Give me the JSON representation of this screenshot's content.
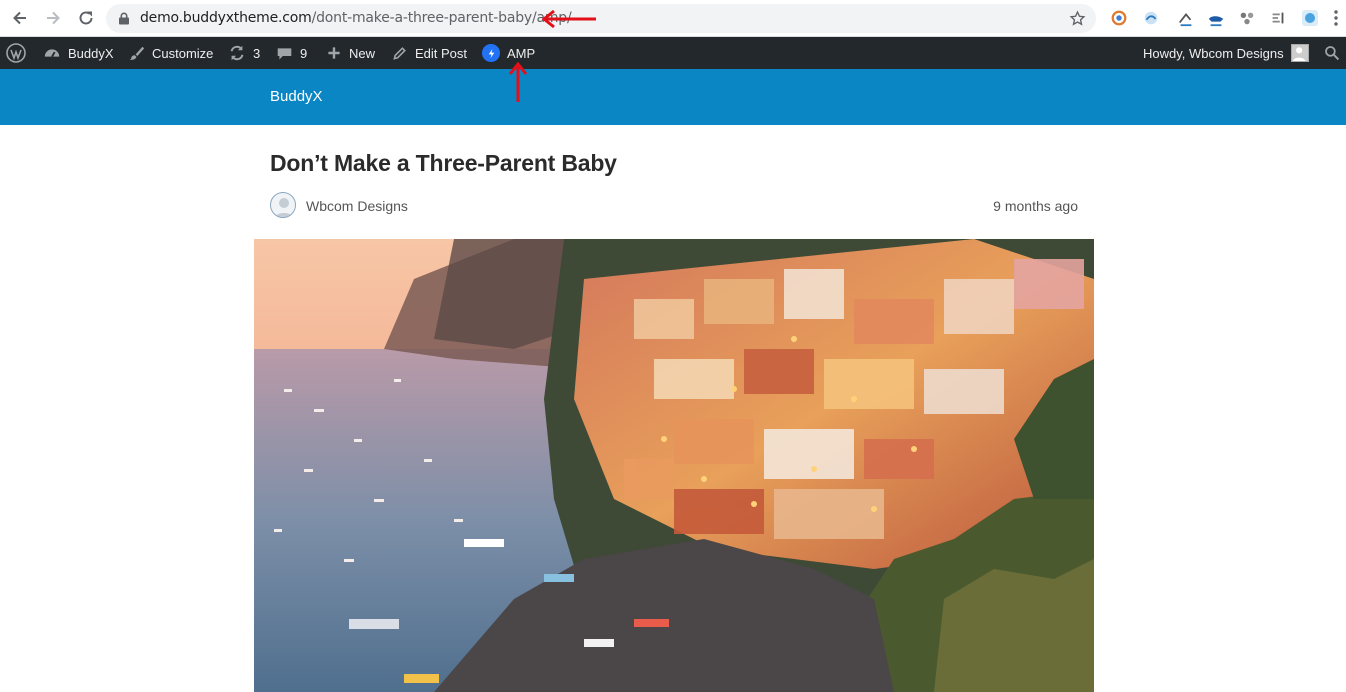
{
  "browser": {
    "url_host": "demo.buddyxtheme.com",
    "url_path": "/dont-make-a-three-parent-baby/amp/"
  },
  "admin_bar": {
    "site_name": "BuddyX",
    "customize": "Customize",
    "updates_count": "3",
    "comments_count": "9",
    "new_label": "New",
    "edit_post": "Edit Post",
    "amp_label": "AMP",
    "howdy": "Howdy, Wbcom Designs"
  },
  "site": {
    "title": "BuddyX",
    "header_color": "#0a86c4"
  },
  "post": {
    "title": "Don’t Make a Three-Parent Baby",
    "author": "Wbcom Designs",
    "date": "9 months ago",
    "image_subject": "Positano coastline at sunset"
  },
  "icons": {
    "back": "arrow-left-icon",
    "forward": "arrow-right-icon",
    "reload": "reload-icon",
    "lock": "lock-icon",
    "star": "star-icon",
    "wp": "wordpress-logo-icon",
    "dashboard": "dashboard-icon",
    "brush": "brush-icon",
    "updates": "updates-icon",
    "comments": "comment-icon",
    "plus": "plus-icon",
    "pencil": "pencil-icon",
    "amp": "amp-bolt-icon",
    "search": "search-icon"
  },
  "colors": {
    "admin_bar": "#23282d",
    "annotation_arrow": "#e3101a",
    "amp_blue": "#2272f6"
  }
}
